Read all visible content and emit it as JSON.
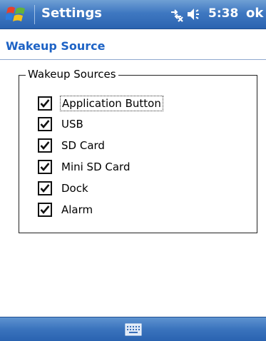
{
  "titlebar": {
    "app_title": "Settings",
    "time": "5:38",
    "ok_label": "ok"
  },
  "page": {
    "title": "Wakeup Source"
  },
  "group": {
    "legend": "Wakeup Sources",
    "options": [
      {
        "label": "Application Button",
        "checked": true,
        "focused": true
      },
      {
        "label": "USB",
        "checked": true
      },
      {
        "label": "SD Card",
        "checked": true
      },
      {
        "label": "Mini SD Card",
        "checked": true
      },
      {
        "label": "Dock",
        "checked": true
      },
      {
        "label": "Alarm",
        "checked": true
      }
    ]
  },
  "icons": {
    "start": "windows-start-icon",
    "connectivity": "connectivity-icon",
    "volume": "volume-icon",
    "keyboard": "keyboard-icon"
  }
}
